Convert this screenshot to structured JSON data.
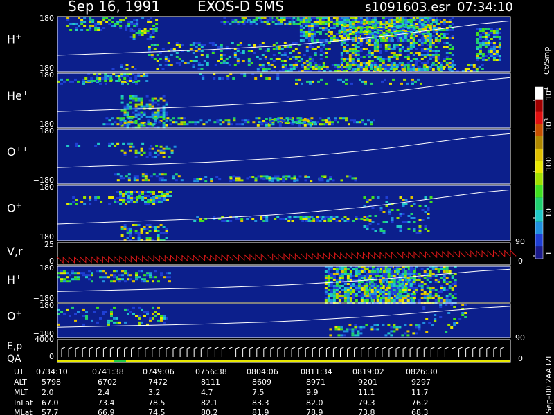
{
  "header": {
    "date": "Sep 16, 1991",
    "mission": "EXOS-D SMS",
    "file": "s1091603.esr",
    "time": "07:34:10"
  },
  "colors": {
    "background": "#000000",
    "panel_fill": "#0c1f8c",
    "trace": "#ffffff",
    "velocity_trace": "#d81818",
    "qa_bar": "#e8e800",
    "qa_mark": "#22cc44"
  },
  "chart_data": {
    "type": "heatmap",
    "colorbar": {
      "title": "Ct/Smp",
      "tick_labels": [
        "1",
        "10",
        "100",
        "10",
        "10"
      ],
      "tick_exponents": [
        "",
        "",
        "",
        "3",
        "4"
      ],
      "colors": [
        "#1a1a8c",
        "#1f3fd4",
        "#2090e0",
        "#20c8c8",
        "#20d070",
        "#40e020",
        "#a0e000",
        "#e8e800",
        "#e0c000",
        "#b08800",
        "#c85000",
        "#e01010",
        "#a00000",
        "#ffffff"
      ]
    },
    "panels": [
      {
        "label": "H",
        "sup": "+",
        "ymax": "180",
        "ymin": "−180",
        "cells": [
          [
            0.12,
            0.0,
            0.25,
            0.2,
            0.4
          ],
          [
            0.12,
            0.3,
            0.1,
            0.2,
            0.5
          ],
          [
            0.19,
            0.2,
            0.4,
            0.06,
            0.6
          ],
          [
            0.22,
            0.85,
            0.96,
            0.2,
            0.2
          ],
          [
            0.4,
            0.45,
            0.9,
            0.4,
            0.3
          ],
          [
            0.46,
            0.0,
            0.12,
            0.2,
            0.4
          ],
          [
            0.5,
            0.0,
            0.15,
            0.2,
            0.5
          ],
          [
            0.69,
            0.85,
            0.98,
            0.5,
            0.6
          ],
          [
            0.69,
            0.0,
            0.45,
            0.31,
            0.6
          ],
          [
            0.72,
            0.05,
            0.3,
            0.2,
            0.7
          ],
          [
            0.75,
            0.0,
            0.95,
            0.25,
            0.5
          ],
          [
            0.95,
            0.2,
            0.8,
            0.05,
            0.7
          ]
        ]
      },
      {
        "label": "He",
        "sup": "+",
        "ymax": "180",
        "ymin": "−180",
        "cells": [
          [
            0.08,
            0.1,
            0.2,
            0.2,
            0.3
          ],
          [
            0.13,
            0.0,
            0.15,
            0.14,
            0.6
          ],
          [
            0.19,
            0.4,
            0.97,
            0.1,
            0.5
          ],
          [
            0.35,
            0.8,
            0.95,
            0.5,
            0.4
          ],
          [
            0.4,
            0.0,
            0.1,
            0.2,
            0.2
          ],
          [
            0.5,
            0.82,
            0.95,
            0.12,
            0.4
          ],
          [
            0.65,
            0.1,
            0.2,
            0.3,
            0.2
          ],
          [
            0.6,
            0.8,
            0.93,
            0.2,
            0.3
          ]
        ]
      },
      {
        "label": "O",
        "sup": "++",
        "ymax": "180",
        "ymin": "−180",
        "cells": [
          [
            0.12,
            0.25,
            0.3,
            0.2,
            0.3
          ],
          [
            0.2,
            0.3,
            0.5,
            0.12,
            0.4
          ],
          [
            0.2,
            0.8,
            0.95,
            0.15,
            0.4
          ],
          [
            0.45,
            0.85,
            0.95,
            0.3,
            0.3
          ],
          [
            0.52,
            0.84,
            0.95,
            0.28,
            0.3
          ]
        ]
      },
      {
        "label": "O",
        "sup": "+",
        "ymax": "180",
        "ymin": "−180",
        "cells": [
          [
            0.12,
            0.2,
            0.35,
            0.2,
            0.3
          ],
          [
            0.19,
            0.1,
            0.3,
            0.12,
            0.6
          ],
          [
            0.19,
            0.7,
            0.98,
            0.1,
            0.4
          ],
          [
            0.45,
            0.55,
            0.63,
            0.3,
            0.4
          ],
          [
            0.6,
            0.55,
            0.66,
            0.18,
            0.5
          ],
          [
            0.75,
            0.2,
            0.9,
            0.15,
            0.2
          ]
        ]
      },
      {
        "label": "H",
        "sup": "+",
        "ymax": "180",
        "ymin": "−180",
        "cells": [
          [
            0.1,
            0.1,
            0.4,
            0.3,
            0.4
          ],
          [
            0.69,
            0.0,
            1.0,
            0.2,
            0.75
          ],
          [
            0.78,
            0.0,
            1.0,
            0.2,
            0.55
          ]
        ]
      },
      {
        "label": "O",
        "sup": "+",
        "ymax": "180",
        "ymin": "−180",
        "cells": [
          [
            0.1,
            0.1,
            0.6,
            0.3,
            0.2
          ],
          [
            0.7,
            0.6,
            0.95,
            0.2,
            0.3
          ],
          [
            0.85,
            0.0,
            0.8,
            0.1,
            0.15
          ]
        ]
      }
    ],
    "velocity_panel": {
      "label": "V,r",
      "y_top": "25",
      "y_zero": "0",
      "right_top": "90",
      "right_zero": "0"
    },
    "energy_panel": {
      "label1": "E,p",
      "label2": "QA",
      "y_top": "4000",
      "y_zero": "0",
      "right_top": "90",
      "right_zero": "0"
    },
    "pitch_trace_norm": [
      0.7,
      0.68,
      0.66,
      0.64,
      0.62,
      0.6,
      0.57,
      0.54,
      0.5,
      0.45,
      0.4,
      0.34,
      0.27,
      0.2,
      0.13,
      0.08
    ],
    "side_label": "Sep–00  2AA32L",
    "x_rows": [
      {
        "label": "UT",
        "values": [
          "0734:10",
          "0741:38",
          "0749:06",
          "0756:38",
          "0804:06",
          "0811:34",
          "0819:02",
          "0826:30"
        ]
      },
      {
        "label": "ALT",
        "values": [
          "5798",
          "6702",
          "7472",
          "8111",
          "8609",
          "8971",
          "9201",
          "9297"
        ]
      },
      {
        "label": "MLT",
        "values": [
          "2.0",
          "2.4",
          "3.2",
          "4.7",
          "7.5",
          "9.9",
          "11.1",
          "11.7"
        ]
      },
      {
        "label": "InLat",
        "values": [
          "67.0",
          "73.4",
          "78.5",
          "82.1",
          "83.3",
          "82.0",
          "79.3",
          "76.2"
        ]
      },
      {
        "label": "MLat",
        "values": [
          "57.7",
          "66.9",
          "74.5",
          "80.2",
          "81.9",
          "78.9",
          "73.8",
          "68.3"
        ]
      }
    ]
  }
}
